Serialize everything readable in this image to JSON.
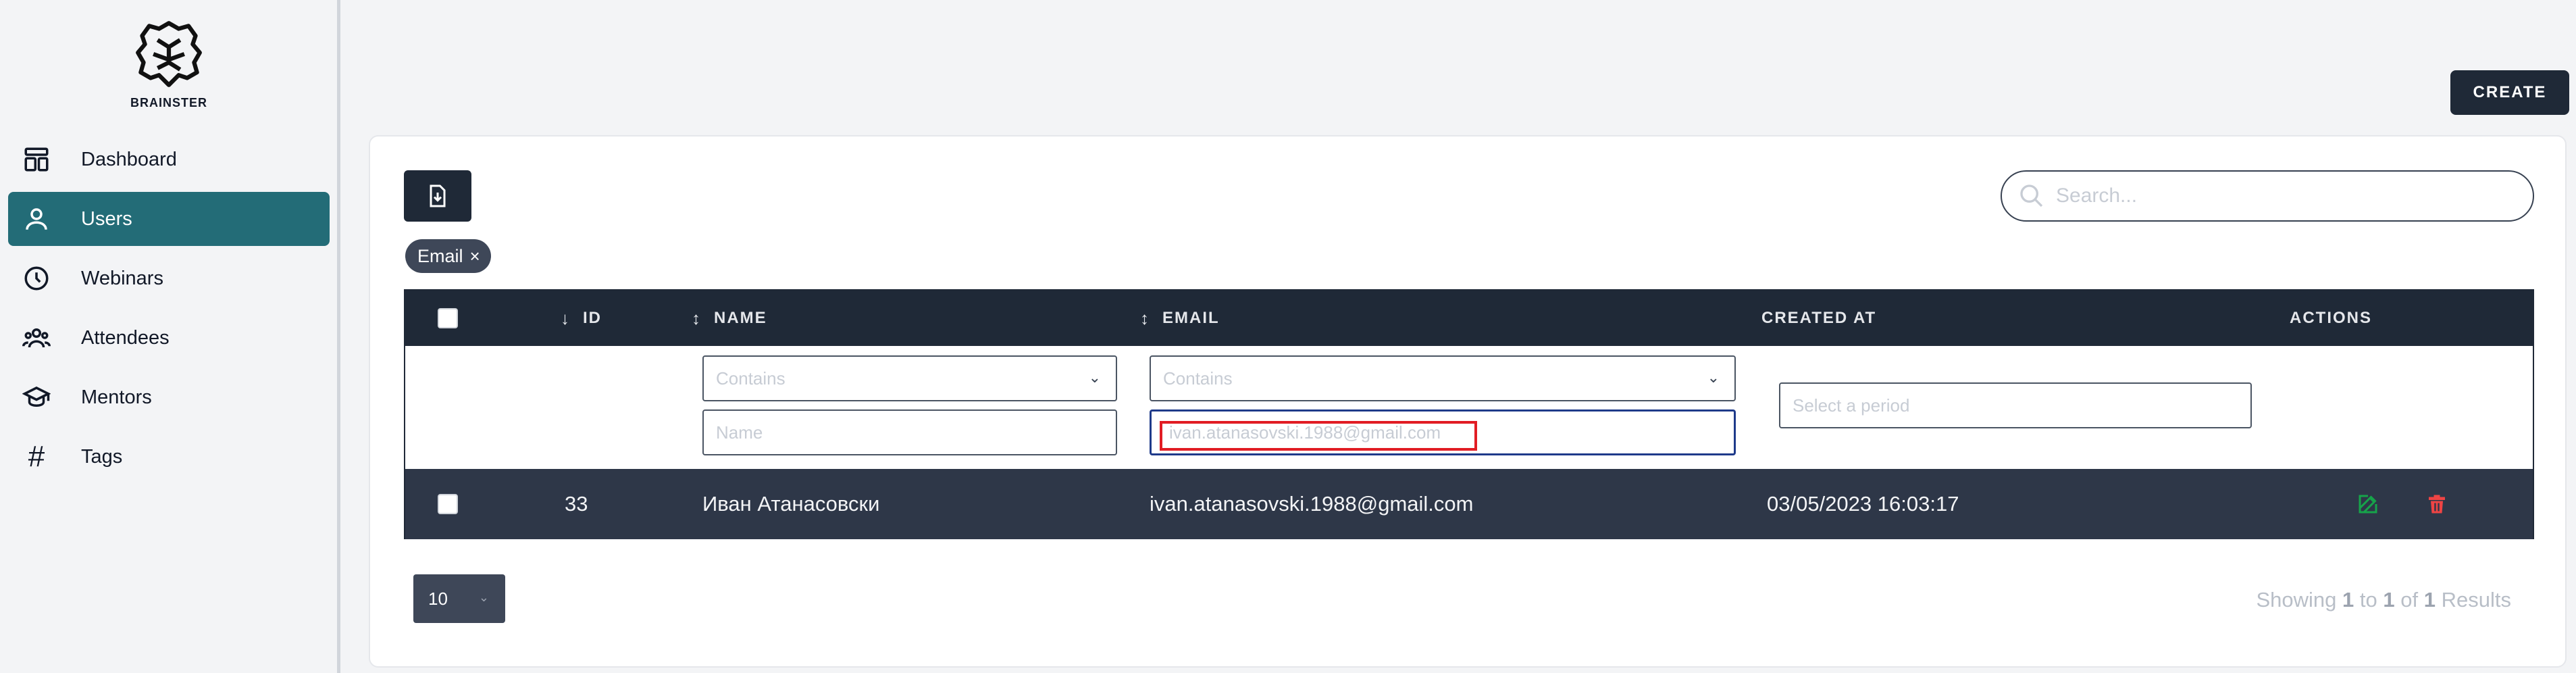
{
  "brand": {
    "name": "BRAINSTER"
  },
  "sidebar": {
    "items": [
      {
        "label": "Dashboard",
        "icon": "dashboard-icon",
        "active": false
      },
      {
        "label": "Users",
        "icon": "user-icon",
        "active": true
      },
      {
        "label": "Webinars",
        "icon": "clock-icon",
        "active": false
      },
      {
        "label": "Attendees",
        "icon": "group-icon",
        "active": false
      },
      {
        "label": "Mentors",
        "icon": "graduation-cap-icon",
        "active": false
      },
      {
        "label": "Tags",
        "icon": "hash-icon",
        "active": false
      }
    ]
  },
  "header": {
    "create_label": "CREATE"
  },
  "toolbar": {
    "search_placeholder": "Search...",
    "active_filter_chip": "Email",
    "chip_close": "×"
  },
  "table": {
    "columns": [
      {
        "label": "ID",
        "sort": "↓"
      },
      {
        "label": "NAME",
        "sort": "↕"
      },
      {
        "label": "EMAIL",
        "sort": "↕"
      },
      {
        "label": "CREATED AT",
        "sort": ""
      },
      {
        "label": "ACTIONS",
        "sort": ""
      }
    ],
    "filters": {
      "name_operator": "Contains",
      "name_placeholder": "Name",
      "email_operator": "Contains",
      "email_value": "ivan.atanasovski.1988@gmail.com",
      "period_placeholder": "Select a period"
    },
    "rows": [
      {
        "id": "33",
        "name": "Иван Атанасовски",
        "email": "ivan.atanasovski.1988@gmail.com",
        "created_at": "03/05/2023 16:03:17"
      }
    ]
  },
  "footer": {
    "page_size": "10",
    "showing_prefix": "Showing",
    "from": "1",
    "to_word": "to",
    "to": "1",
    "of_word": "of",
    "total": "1",
    "results_word": "Results"
  },
  "colors": {
    "accent": "#236c77",
    "header_bg": "#1f2937",
    "row_bg": "#2e3748",
    "edit": "#22c55e",
    "delete": "#ef4444",
    "highlight": "#e11d24"
  }
}
